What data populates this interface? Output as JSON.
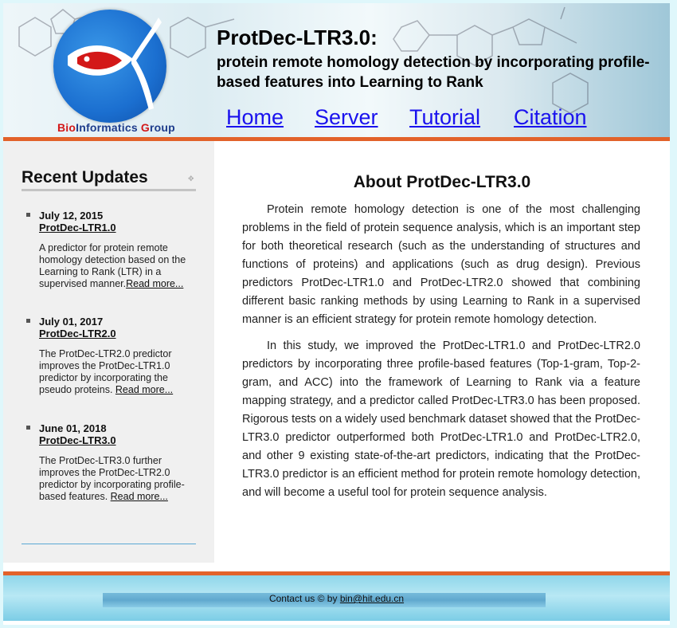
{
  "header": {
    "logo_text_part1": "Bio",
    "logo_text_part2": "Informatics ",
    "logo_text_part3": "G",
    "logo_text_part4": "roup",
    "title": "ProtDec-LTR3.0:",
    "subtitle": "protein remote homology detection by incorporating profile-based features into Learning to Rank",
    "nav": [
      "Home",
      "Server",
      "Tutorial",
      "Citation"
    ]
  },
  "sidebar": {
    "title": "Recent Updates",
    "updates": [
      {
        "date": "July 12, 2015",
        "link": "ProtDec-LTR1.0",
        "desc": "A predictor for protein remote homology detection based on the Learning to Rank (LTR) in a supervised manner.",
        "more": "Read more..."
      },
      {
        "date": "July 01, 2017",
        "link": "ProtDec-LTR2.0",
        "desc": "The ProtDec-LTR2.0 predictor improves the ProtDec-LTR1.0 predictor by incorporating the pseudo proteins. ",
        "more": "Read more..."
      },
      {
        "date": "June 01, 2018",
        "link": "ProtDec-LTR3.0",
        "desc": "The ProtDec-LTR3.0 further improves the ProtDec-LTR2.0 predictor by incorporating profile-based features. ",
        "more": "Read more..."
      }
    ]
  },
  "main": {
    "title": "About ProtDec-LTR3.0",
    "paragraphs": [
      "Protein remote homology detection is one of the most challenging problems in the field of protein sequence analysis, which is an important step for both theoretical research (such as the understanding of structures and functions of proteins) and applications (such as drug design). Previous predictors ProtDec-LTR1.0 and ProtDec-LTR2.0 showed that combining different basic ranking methods by using Learning to Rank in a supervised manner is an efficient strategy for protein remote homology detection.",
      "In this study, we improved the ProtDec-LTR1.0 and ProtDec-LTR2.0 predictors by incorporating three profile-based features (Top-1-gram, Top-2-gram, and ACC) into the framework of Learning to Rank via a feature mapping strategy, and a predictor called ProtDec-LTR3.0 has been proposed. Rigorous tests on a widely used benchmark dataset showed that the ProtDec-LTR3.0 predictor outperformed both ProtDec-LTR1.0 and ProtDec-LTR2.0, and other 9 existing state-of-the-art predictors, indicating that the ProtDec-LTR3.0 predictor is an efficient method for protein remote homology detection, and will become a useful tool for protein sequence analysis."
    ]
  },
  "footer": {
    "prefix": "Contact us © by ",
    "email": "bin@hit.edu.cn"
  },
  "colors": {
    "accent_orange": "#e2622a",
    "nav_link": "#1a12ee",
    "logo_blue": "#1b6fd0",
    "logo_red": "#d31818"
  }
}
